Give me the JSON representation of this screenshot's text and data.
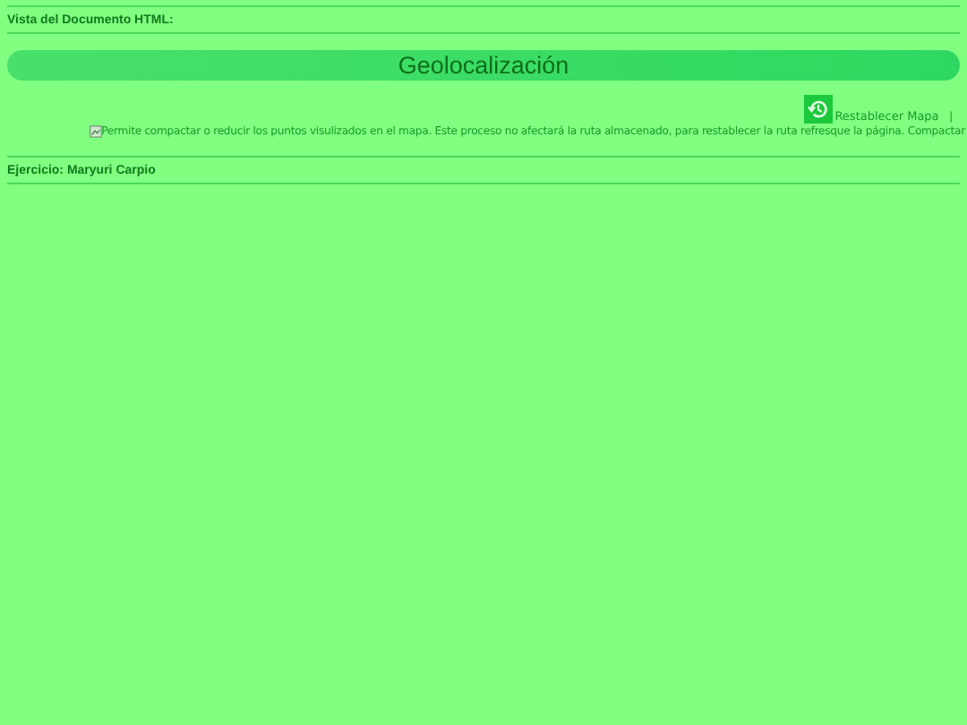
{
  "document_label": "Vista del Documento HTML:",
  "header": {
    "title": "Geolocalización"
  },
  "toolbar": {
    "reset_button": {
      "label": "Restablecer Mapa"
    },
    "separator": "|"
  },
  "broken_image": {
    "alt": "Permite compactar o reducir los puntos visulizados en el mapa. Este proceso no afectará la ruta almacenado, para restablecer la ruta refresque la página. Compactar"
  },
  "footer_label": "Ejercicio: Maryuri Carpio"
}
